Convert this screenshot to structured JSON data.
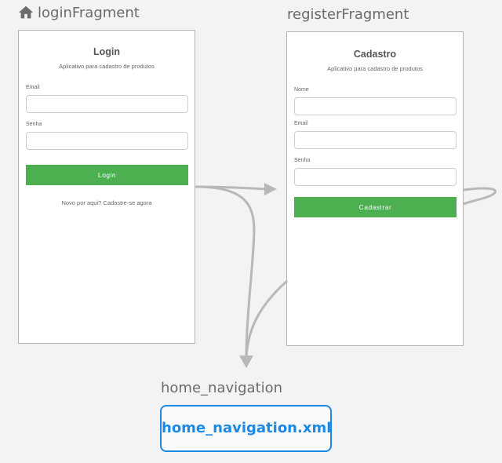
{
  "nav_graph": {
    "start_icon": "home-icon",
    "colors": {
      "background": "#f3f3f3",
      "arrow": "#b8b8b8",
      "button": "#4caf50",
      "graph_border": "#1e88e5"
    }
  },
  "login": {
    "dest_title": "loginFragment",
    "title": "Login",
    "subtitle": "Aplicativo para cadastro de produtos",
    "email_label": "Email",
    "password_label": "Senha",
    "button": "Login",
    "register_link": "Novo por aqui? Cadastre-se agora"
  },
  "register": {
    "dest_title": "registerFragment",
    "title": "Cadastro",
    "subtitle": "Aplicativo para cadastro de produtos",
    "name_label": "Nome",
    "email_label": "Email",
    "password_label": "Senha",
    "button": "Cadastrar"
  },
  "home": {
    "dest_title": "home_navigation",
    "graph_file": "home_navigation.xml"
  }
}
